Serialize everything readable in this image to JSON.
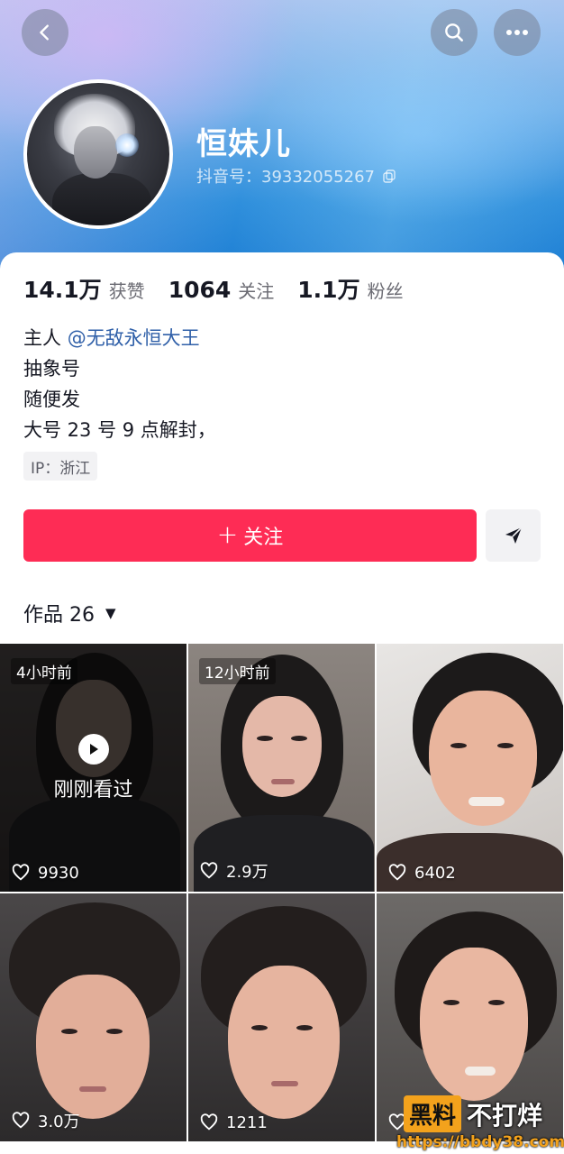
{
  "header": {
    "nickname": "恒妹儿",
    "douyin_id": "抖音号：39332055267"
  },
  "stats": [
    {
      "value": "14.1万",
      "label": "获赞"
    },
    {
      "value": "1064",
      "label": "关注"
    },
    {
      "value": "1.1万",
      "label": "粉丝"
    }
  ],
  "bio": {
    "line1_prefix": "主人 ",
    "line1_mention": "@无敌永恒大王",
    "line2": "抽象号",
    "line3": "随便发",
    "line4": "大号 23 号 9 点解封，"
  },
  "ip": "IP：浙江",
  "actions": {
    "follow_plus": "+",
    "follow_label": "关注"
  },
  "works_tab": {
    "label": "作品 26",
    "caret": "▼"
  },
  "videos": [
    {
      "likes": "9930",
      "time": "4小时前",
      "overlay": "刚刚看过"
    },
    {
      "likes": "2.9万",
      "time": "12小时前"
    },
    {
      "likes": "6402"
    },
    {
      "likes": "3.0万"
    },
    {
      "likes": "1211"
    },
    {
      "likes": ""
    }
  ],
  "watermark": {
    "badge": "黑料",
    "text": "不打烊",
    "url": "https://bbdy38.com"
  },
  "colors": {
    "accent": "#fe2c55",
    "mention": "#2f5fa8",
    "watermark": "#f3a21c"
  }
}
